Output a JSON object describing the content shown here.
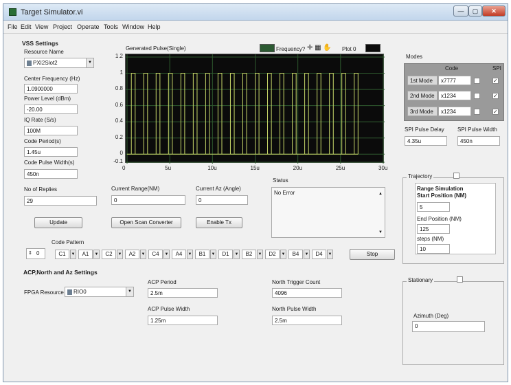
{
  "window": {
    "title": "Target Simulator.vi",
    "minimize_label": "—",
    "maximize_label": "▢",
    "close_label": "✕"
  },
  "menu": [
    "File",
    "Edit",
    "View",
    "Project",
    "Operate",
    "Tools",
    "Window",
    "Help"
  ],
  "vss": {
    "title": "VSS Settings",
    "resource_name_label": "Resource Name",
    "resource_name_value": "PXI2Slot2",
    "center_freq_label": "Center Frequency (Hz)",
    "center_freq_value": "1.0900000",
    "power_level_label": "Power Level (dBm)",
    "power_level_value": "-20.00",
    "iq_rate_label": "IQ Rate (S/s)",
    "iq_rate_value": "100M",
    "code_period_label": "Code Period(s)",
    "code_period_value": "1.45u",
    "code_pulse_width_label": "Code Pulse Width(s)",
    "code_pulse_width_value": "450n",
    "num_replies_label": "No of Replies",
    "num_replies_value": "29",
    "update_button": "Update"
  },
  "chart_data": {
    "type": "line",
    "title": "Generated Pulse(Single)",
    "legend": "Plot 0",
    "legend_extra": "Frequency?",
    "xlabel": "",
    "ylabel": "",
    "x_ticks": [
      "0",
      "5u",
      "10u",
      "15u",
      "20u",
      "25u",
      "30u"
    ],
    "y_ticks": [
      "1.2",
      "1",
      "0.8",
      "0.6",
      "0.4",
      "0.2",
      "0",
      "-0.1"
    ],
    "xlim": [
      0,
      30
    ],
    "ylim": [
      -0.1,
      1.2
    ],
    "x_unit": "microseconds",
    "pulse_width_us": 0.45,
    "pulse_level": 1,
    "pulse_starts_us": [
      0.5,
      1.95,
      3.4,
      4.85,
      6.3,
      7.75,
      9.2,
      10.65,
      12.1,
      13.55,
      15.0,
      16.45,
      17.9,
      19.35,
      20.8,
      22.25,
      23.7,
      25.15,
      26.6
    ],
    "grid": true,
    "legend_position": "top-right"
  },
  "current_range_label": "Current Range(NM)",
  "current_range_value": "0",
  "current_az_label": "Current Az (Angle)",
  "current_az_value": "0",
  "open_scan_button": "Open Scan Converter",
  "enable_tx_button": "Enable Tx",
  "status": {
    "label": "Status",
    "value": "No Error"
  },
  "code_pattern": {
    "label": "Code Pattern",
    "index_value": "0",
    "items": [
      "C1",
      "A1",
      "C2",
      "A2",
      "C4",
      "A4",
      "B1",
      "D1",
      "B2",
      "D2",
      "B4",
      "D4"
    ],
    "stop_button": "Stop"
  },
  "acp": {
    "title": "ACP,North and Az Settings",
    "fpga_label": "FPGA Resource",
    "fpga_value": "RIO0",
    "acp_period_label": "ACP Period",
    "acp_period_value": "2.5m",
    "acp_pulse_width_label": "ACP Pulse Width",
    "acp_pulse_width_value": "1.25m",
    "north_trigger_label": "North Trigger Count",
    "north_trigger_value": "4096",
    "north_pulse_width_label": "North Pulse Width",
    "north_pulse_width_value": "2.5m"
  },
  "modes": {
    "title": "Modes",
    "code_header": "Code",
    "spi_header": "SPI",
    "rows": [
      {
        "label": "1st Mode",
        "code": "x7777"
      },
      {
        "label": "2nd Mode",
        "code": "x1234"
      },
      {
        "label": "3rd Mode",
        "code": "x1234"
      }
    ],
    "spi_pulse_delay_label": "SPI Pulse Delay",
    "spi_pulse_delay_value": "4.35u",
    "spi_pulse_width_label": "SPI Pulse Width",
    "spi_pulse_width_value": "450n"
  },
  "trajectory": {
    "title": "Trajectory",
    "range_sim_label": "Range Simulation",
    "start_pos_label": "Start Position (NM)",
    "start_pos_value": "5",
    "end_pos_label": "End Position (NM)",
    "end_pos_value": "125",
    "steps_label": "steps (NM)",
    "steps_value": "10"
  },
  "stationary": {
    "title": "Stationary",
    "azimuth_label": "Azimuth (Deg)",
    "azimuth_value": "0"
  },
  "colors": {
    "plot_bg": "#0b0b0b",
    "grid": "#2f5a2f",
    "trace": "#c9d96a",
    "legend_swatch": "#2c5a32",
    "modes_panel": "#9a9a9a"
  }
}
